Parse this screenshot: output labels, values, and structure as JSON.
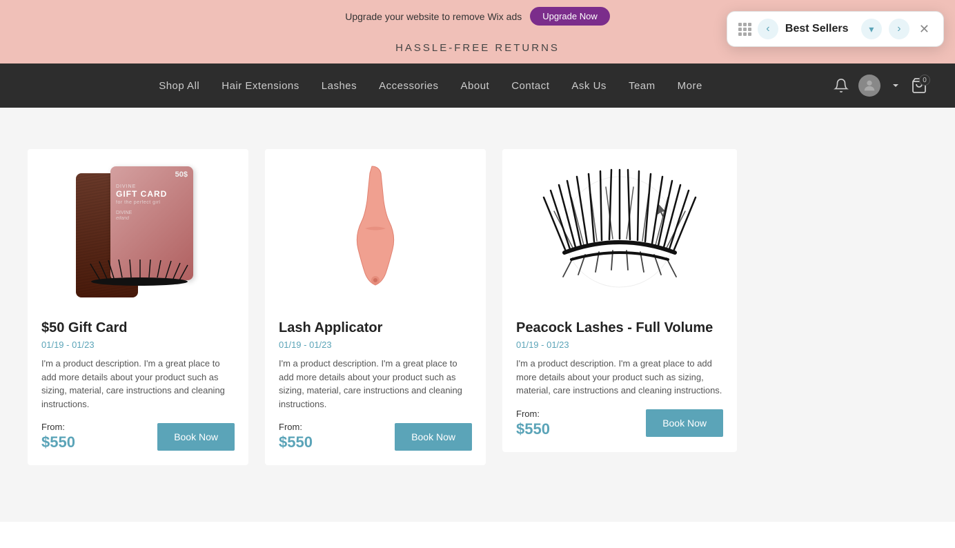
{
  "ad_banner": {
    "text": "Upgrade your website to remove Wix ads",
    "button_label": "Upgrade Now"
  },
  "promo_banner": {
    "text": "HASSLE-FREE RETURNS"
  },
  "navbar": {
    "links": [
      {
        "id": "shop-all",
        "label": "Shop All"
      },
      {
        "id": "hair-extensions",
        "label": "Hair Extensions"
      },
      {
        "id": "lashes",
        "label": "Lashes"
      },
      {
        "id": "accessories",
        "label": "Accessories"
      },
      {
        "id": "about",
        "label": "About"
      },
      {
        "id": "contact",
        "label": "Contact"
      },
      {
        "id": "ask-us",
        "label": "Ask Us"
      },
      {
        "id": "team",
        "label": "Team"
      },
      {
        "id": "more",
        "label": "More"
      }
    ],
    "cart_count": "0"
  },
  "products": [
    {
      "id": "gift-card",
      "title": "$50 Gift Card",
      "date": "01/19 - 01/23",
      "description": "I'm a product description. I'm a great place to add more details about your product such as sizing, material, care instructions and cleaning instructions.",
      "price_label": "From:",
      "price": "$550",
      "button_label": "Book Now"
    },
    {
      "id": "lash-applicator",
      "title": "Lash Applicator",
      "date": "01/19 - 01/23",
      "description": "I'm a product description. I'm a great place to add more details about your product such as sizing, material, care instructions and cleaning instructions.",
      "price_label": "From:",
      "price": "$550",
      "button_label": "Book Now"
    },
    {
      "id": "peacock-lashes",
      "title": "Peacock Lashes - Full Volume",
      "date": "01/19 - 01/23",
      "description": "I'm a product description. I'm a great place to add more details about your product such as sizing, material, care instructions and cleaning instructions.",
      "price_label": "From:",
      "price": "$550",
      "button_label": "Book Now"
    }
  ],
  "floating_panel": {
    "title": "Best Sellers",
    "prev_label": "‹",
    "next_label": "›",
    "close_label": "✕",
    "dropdown_label": "▾"
  },
  "colors": {
    "accent": "#5ba4b8",
    "dark_nav": "#2d2d2d",
    "promo_bg": "#f0c0b8",
    "upgrade_purple": "#7B2D8B"
  }
}
